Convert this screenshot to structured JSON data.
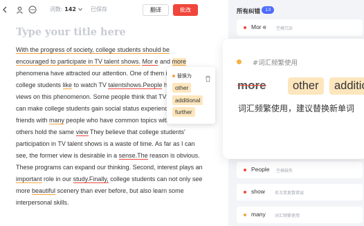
{
  "toolbar": {
    "word_count_label": "词数:",
    "word_count": "142",
    "saved_status": "已保存",
    "translate_label": "翻译",
    "correct_label": "批改"
  },
  "editor": {
    "title_placeholder": "Type your title here"
  },
  "popup": {
    "title": "替换为",
    "options": [
      "other",
      "additional",
      "further"
    ]
  },
  "panel": {
    "title": "所有纠错",
    "count": "13",
    "items": [
      {
        "word": "Mor e",
        "note": "空格冗余"
      },
      {
        "word": "People",
        "note": "空格缺失"
      },
      {
        "word": "show",
        "note": "名次单复数错误"
      },
      {
        "word": "many",
        "note": "词汇频繁使用"
      }
    ],
    "card": {
      "category": "#词汇频繁使用",
      "original": "more",
      "candidates": [
        "other",
        "additional"
      ],
      "description": "词汇频繁使用，建议替换新单词"
    }
  },
  "colors": {
    "accent_red": "#f0453a",
    "accent_orange": "#f3a43a",
    "highlight": "#fde6bd",
    "badge_blue": "#4d6bfe"
  }
}
